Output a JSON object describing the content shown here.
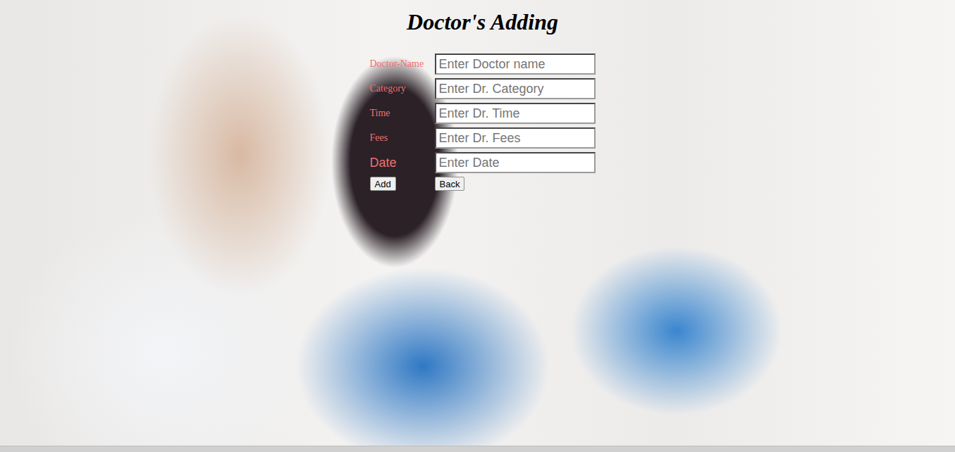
{
  "title": "Doctor's Adding",
  "form": {
    "fields": [
      {
        "label": "Doctor-Name",
        "placeholder": "Enter Doctor name",
        "kind": "serif"
      },
      {
        "label": "Category",
        "placeholder": "Enter Dr. Category",
        "kind": "serif"
      },
      {
        "label": "Time",
        "placeholder": "Enter Dr. Time",
        "kind": "serif"
      },
      {
        "label": "Fees",
        "placeholder": "Enter Dr. Fees",
        "kind": "serif"
      },
      {
        "label": "Date",
        "placeholder": "Enter Date",
        "kind": "sans"
      }
    ]
  },
  "buttons": [
    "Add",
    "Back"
  ]
}
